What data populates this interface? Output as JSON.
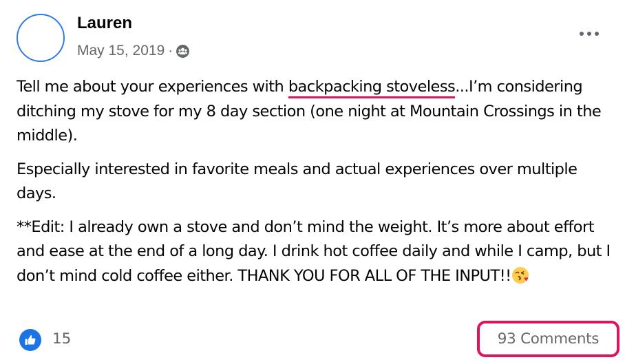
{
  "post": {
    "author": "Lauren",
    "date": "May 15, 2019",
    "separator": "·",
    "audience_icon": "group-audience-icon",
    "more_icon": "more-options-icon",
    "paragraphs": {
      "p1_before": "Tell me about your experiences with ",
      "p1_highlight": "backpacking stoveless",
      "p1_after": "...I’m considering ditching my stove for my 8 day section (one night at Mountain Crossings in the middle).",
      "p2": "Especially interested in favorite meals and actual experiences over multiple days.",
      "p3": "**Edit: I already own a stove and don’t mind the weight. It’s more about effort and ease at the end of a long day. I drink hot coffee daily and while I camp, but I don’t mind cold coffee either. THANK YOU FOR ALL OF THE INPUT!!"
    },
    "emoji": "face-blowing-kiss-emoji"
  },
  "reactions": {
    "icon": "like-thumbs-up-icon",
    "count": "15"
  },
  "comments": {
    "label": "93 Comments"
  },
  "colors": {
    "highlight": "#e0145c",
    "like_blue": "#1b74e4",
    "avatar_ring": "#2d7be6",
    "secondary_text": "#65676b"
  }
}
